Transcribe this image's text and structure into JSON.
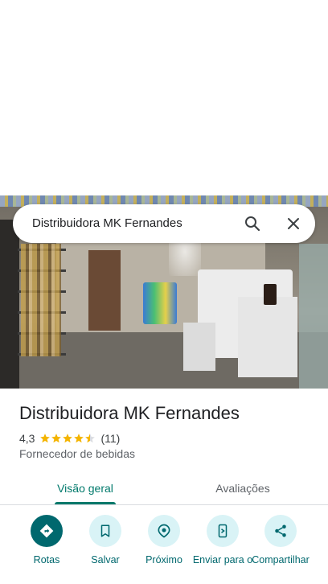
{
  "search": {
    "query": "Distribuidora MK Fernandes"
  },
  "place": {
    "name": "Distribuidora MK Fernandes",
    "rating": "4,3",
    "stars": 4.3,
    "review_count": "(11)",
    "category": "Fornecedor de bebidas"
  },
  "tabs": [
    {
      "label": "Visão geral",
      "selected": true
    },
    {
      "label": "Avaliações",
      "selected": false
    }
  ],
  "actions": [
    {
      "label": "Rotas",
      "icon": "directions-icon"
    },
    {
      "label": "Salvar",
      "icon": "bookmark-icon"
    },
    {
      "label": "Próximo",
      "icon": "nearby-icon"
    },
    {
      "label": "Enviar para o",
      "icon": "send-to-phone-icon"
    },
    {
      "label": "Compartilhar",
      "icon": "share-icon"
    }
  ],
  "colors": {
    "accent": "#00796b",
    "action_fill": "#d9f3f6",
    "primary_fill": "#00686e",
    "star": "#f4b400"
  }
}
